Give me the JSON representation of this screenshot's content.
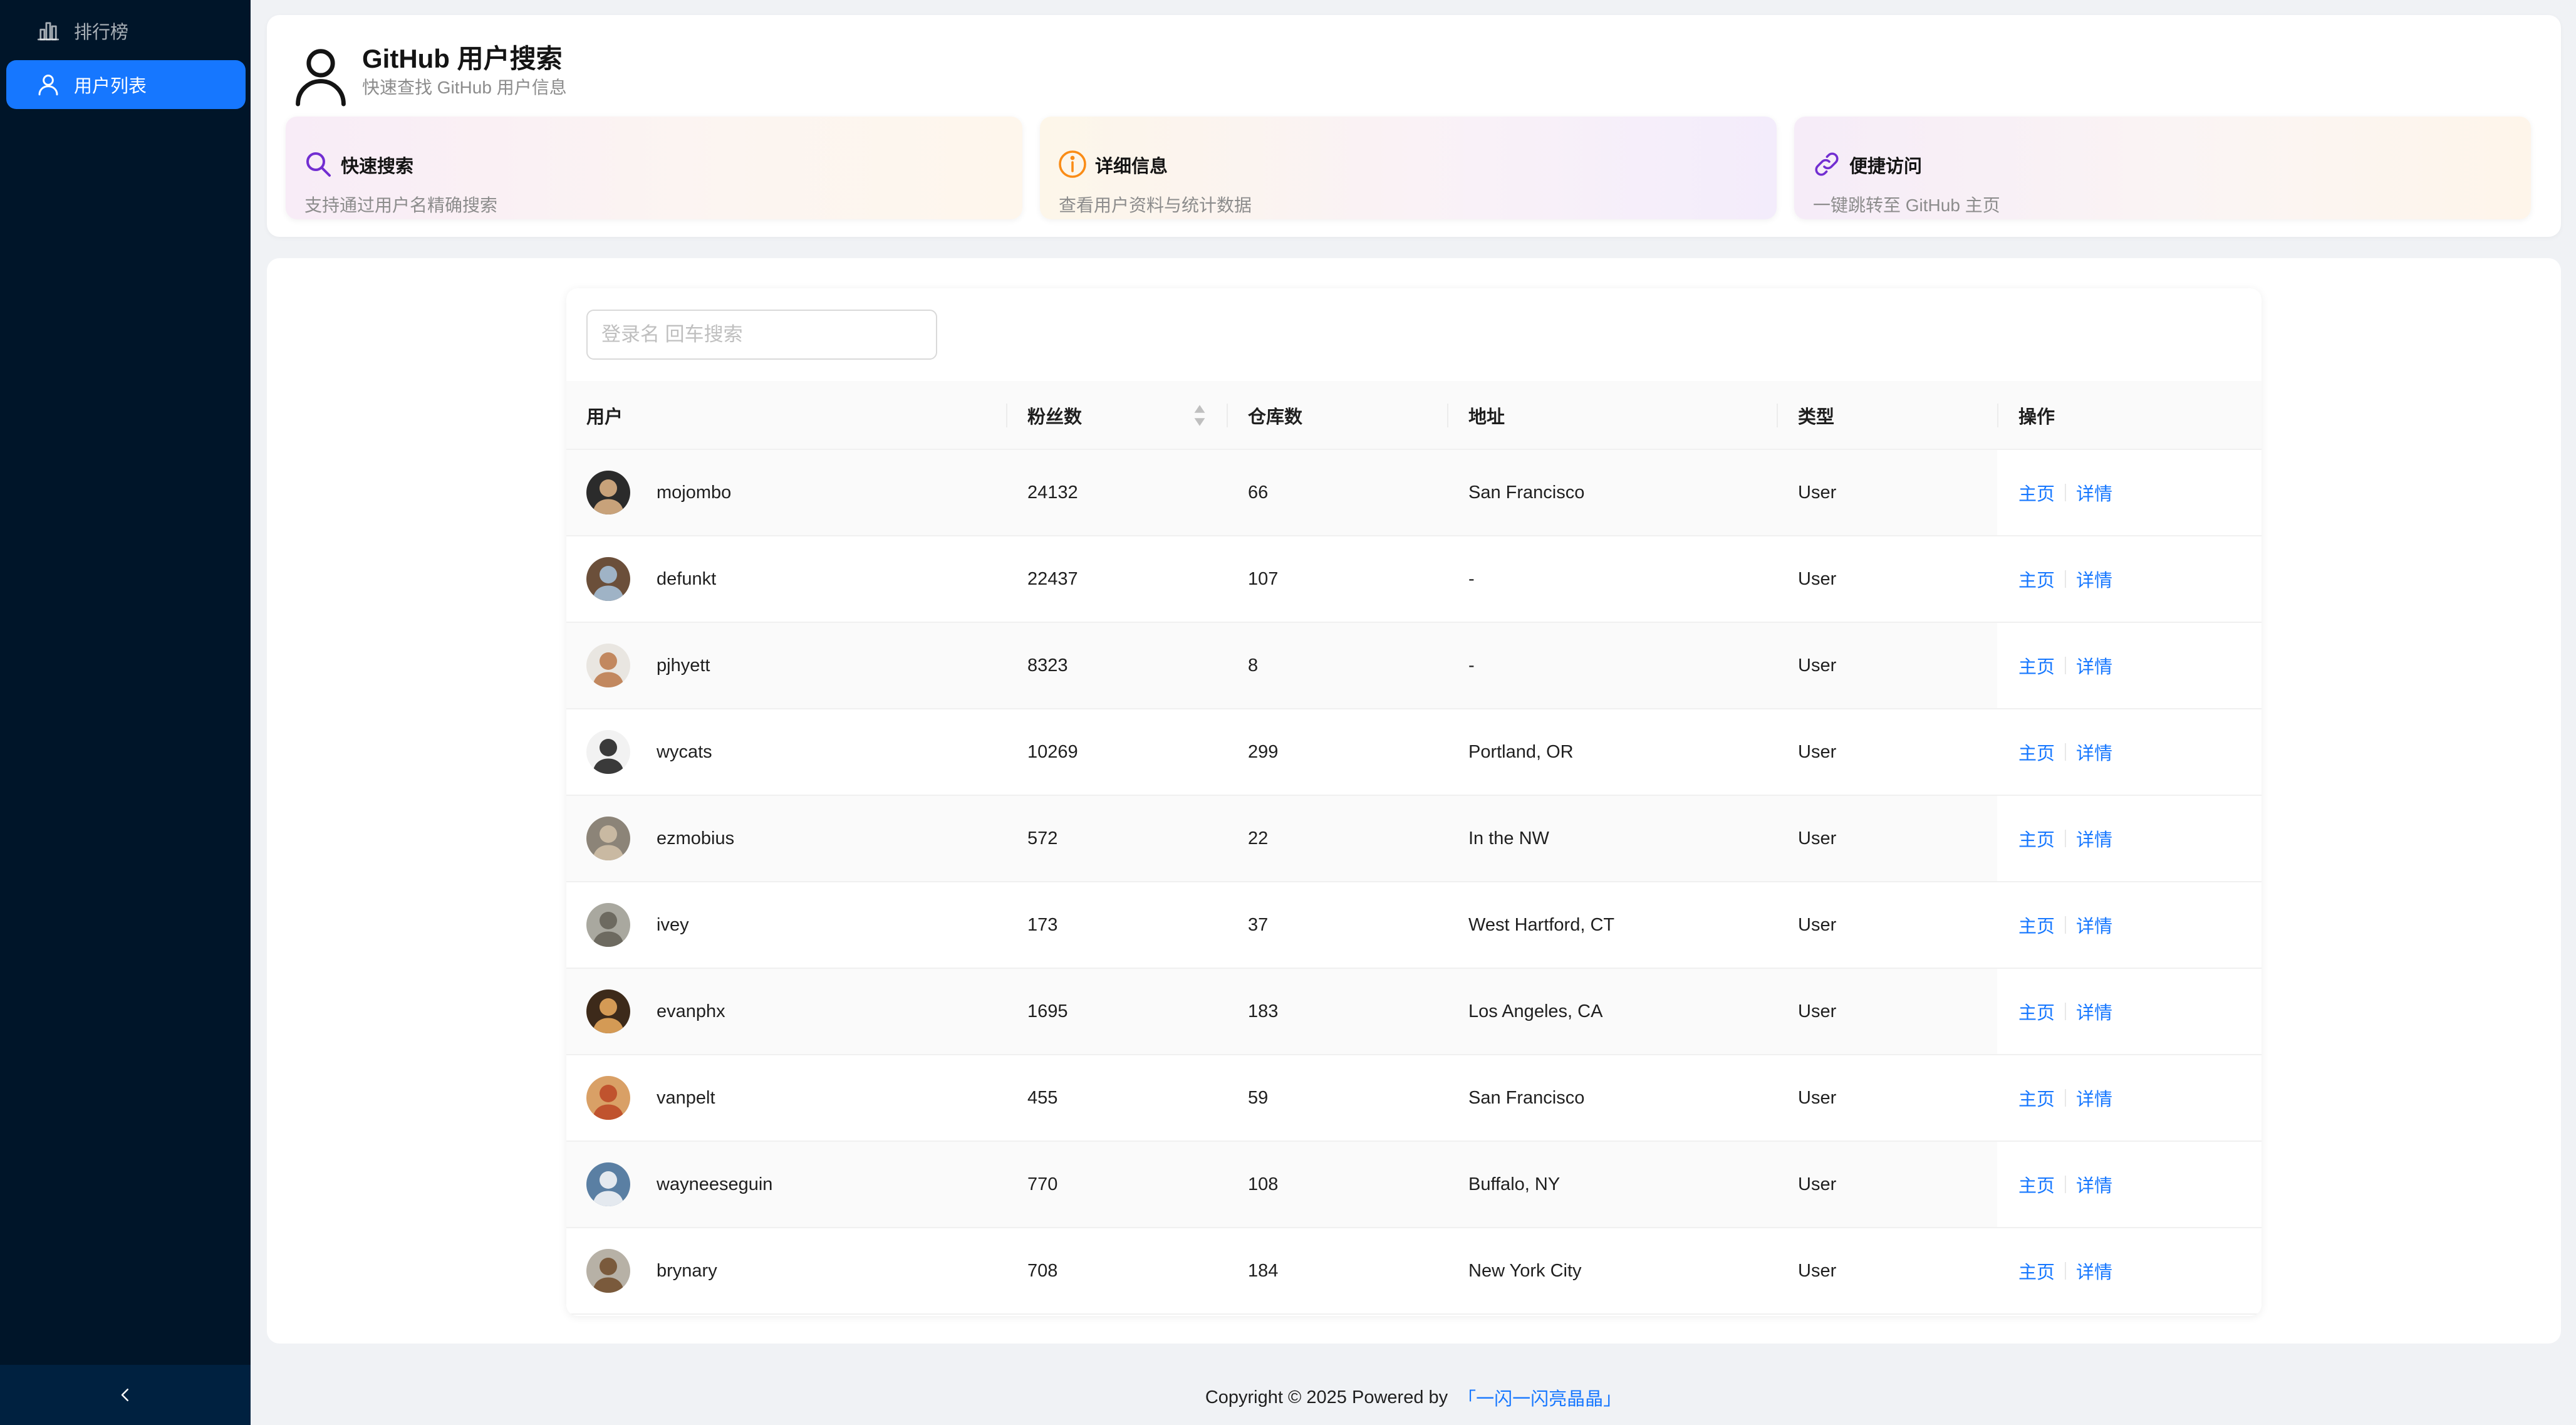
{
  "sidebar": {
    "items": [
      {
        "label": "排行榜",
        "icon": "bar-chart-icon",
        "active": false
      },
      {
        "label": "用户列表",
        "icon": "user-icon",
        "active": true
      }
    ],
    "collapse_icon": "chevron-left-icon"
  },
  "header": {
    "title": "GitHub 用户搜索",
    "subtitle": "快速查找 GitHub 用户信息",
    "features": [
      {
        "title": "快速搜索",
        "desc": "支持通过用户名精确搜索",
        "icon": "search-icon",
        "color": "#722ed1"
      },
      {
        "title": "详细信息",
        "desc": "查看用户资料与统计数据",
        "icon": "info-circle-icon",
        "color": "#fa8c16"
      },
      {
        "title": "便捷访问",
        "desc": "一键跳转至 GitHub 主页",
        "icon": "link-icon",
        "color": "#722ed1"
      }
    ]
  },
  "search": {
    "placeholder": "登录名 回车搜索",
    "value": ""
  },
  "table": {
    "columns": [
      "用户",
      "粉丝数",
      "仓库数",
      "地址",
      "类型",
      "操作"
    ],
    "action_labels": {
      "home": "主页",
      "detail": "详情"
    },
    "rows": [
      {
        "login": "mojombo",
        "followers": "24132",
        "repos": "66",
        "location": "San Francisco",
        "type": "User"
      },
      {
        "login": "defunkt",
        "followers": "22437",
        "repos": "107",
        "location": "-",
        "type": "User"
      },
      {
        "login": "pjhyett",
        "followers": "8323",
        "repos": "8",
        "location": "-",
        "type": "User"
      },
      {
        "login": "wycats",
        "followers": "10269",
        "repos": "299",
        "location": "Portland, OR",
        "type": "User"
      },
      {
        "login": "ezmobius",
        "followers": "572",
        "repos": "22",
        "location": "In the NW",
        "type": "User"
      },
      {
        "login": "ivey",
        "followers": "173",
        "repos": "37",
        "location": "West Hartford, CT",
        "type": "User"
      },
      {
        "login": "evanphx",
        "followers": "1695",
        "repos": "183",
        "location": "Los Angeles, CA",
        "type": "User"
      },
      {
        "login": "vanpelt",
        "followers": "455",
        "repos": "59",
        "location": "San Francisco",
        "type": "User"
      },
      {
        "login": "wayneeseguin",
        "followers": "770",
        "repos": "108",
        "location": "Buffalo, NY",
        "type": "User"
      },
      {
        "login": "brynary",
        "followers": "708",
        "repos": "184",
        "location": "New York City",
        "type": "User"
      }
    ]
  },
  "footer": {
    "text": "Copyright © 2025 Powered by",
    "link": "「一闪一闪亮晶晶」"
  },
  "colors": {
    "sidebar_bg": "#001529",
    "primary": "#1677ff",
    "page_bg": "#f0f2f5"
  }
}
